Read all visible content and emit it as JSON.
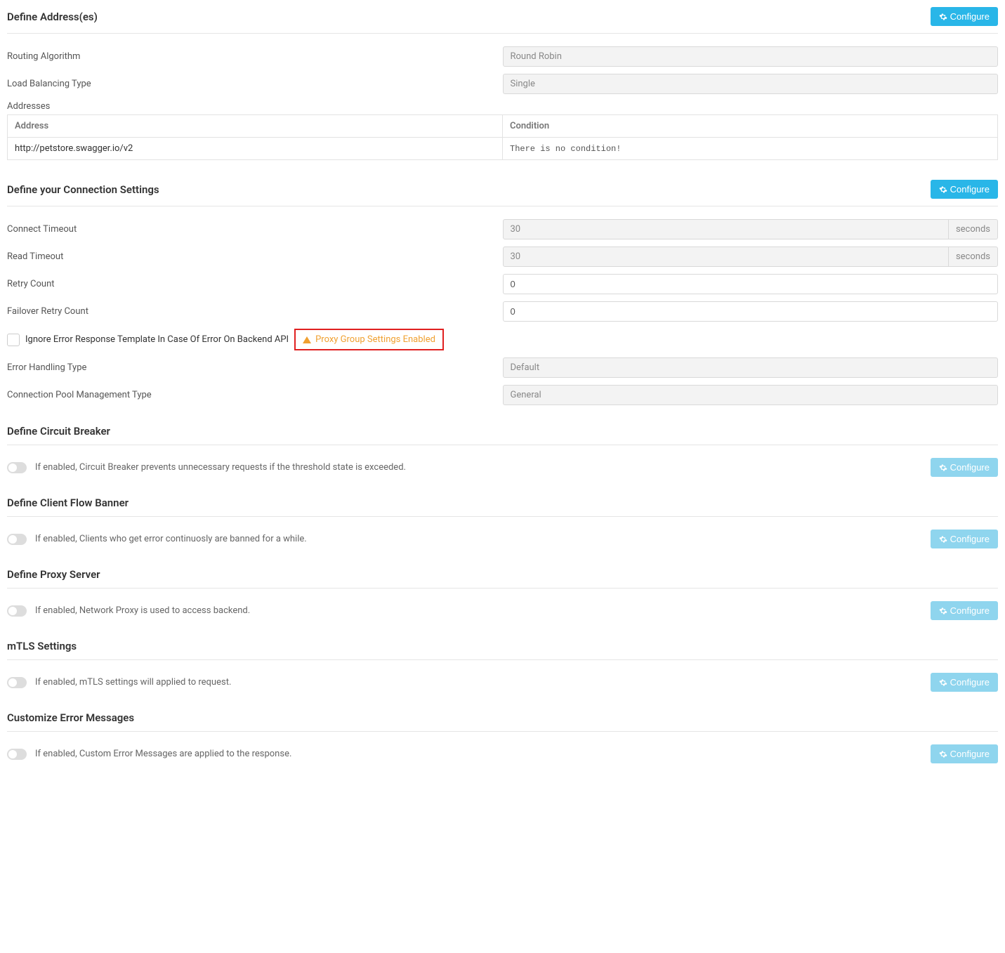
{
  "buttons": {
    "configure": "Configure"
  },
  "units": {
    "seconds": "seconds"
  },
  "addresses": {
    "title": "Define Address(es)",
    "routing_algorithm_label": "Routing Algorithm",
    "routing_algorithm_value": "Round Robin",
    "load_balancing_label": "Load Balancing Type",
    "load_balancing_value": "Single",
    "addresses_label": "Addresses",
    "table": {
      "header_address": "Address",
      "header_condition": "Condition",
      "rows": [
        {
          "address": "http://petstore.swagger.io/v2",
          "condition": "There is no condition!"
        }
      ]
    }
  },
  "connection": {
    "title": "Define your Connection Settings",
    "connect_timeout_label": "Connect Timeout",
    "connect_timeout_value": "30",
    "read_timeout_label": "Read Timeout",
    "read_timeout_value": "30",
    "retry_count_label": "Retry Count",
    "retry_count_value": "0",
    "failover_retry_label": "Failover Retry Count",
    "failover_retry_value": "0",
    "ignore_error_label": "Ignore Error Response Template In Case Of Error On Backend API",
    "proxy_group_badge": "Proxy Group Settings Enabled",
    "error_handling_label": "Error Handling Type",
    "error_handling_value": "Default",
    "pool_mgmt_label": "Connection Pool Management Type",
    "pool_mgmt_value": "General"
  },
  "circuit_breaker": {
    "title": "Define Circuit Breaker",
    "desc": "If enabled, Circuit Breaker prevents unnecessary requests if the threshold state is exceeded."
  },
  "client_flow": {
    "title": "Define Client Flow Banner",
    "desc": "If enabled, Clients who get error continuosly are banned for a while."
  },
  "proxy_server": {
    "title": "Define Proxy Server",
    "desc": "If enabled, Network Proxy is used to access backend."
  },
  "mtls": {
    "title": "mTLS Settings",
    "desc": "If enabled, mTLS settings will applied to request."
  },
  "custom_errors": {
    "title": "Customize Error Messages",
    "desc": "If enabled, Custom Error Messages are applied to the response."
  }
}
